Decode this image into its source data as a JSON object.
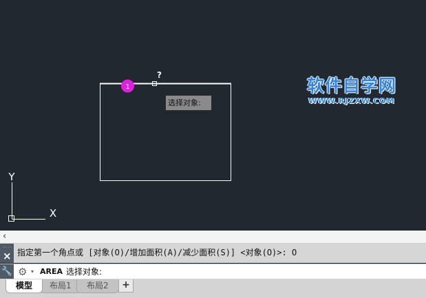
{
  "canvas": {
    "cursor_query": "?",
    "step_marker": "1",
    "axis_y_label": "Y",
    "axis_x_label": "X",
    "tooltip_text": "选择对象:"
  },
  "watermark": {
    "title": "软件自学网",
    "url": "WWW.RJZXW.COM"
  },
  "command_line": {
    "collapse_glyph": "‹",
    "history_text": "指定第一个角点或 [对象(O)/增加面积(A)/减少面积(S)] <对象(O)>: O",
    "close_glyph": "×",
    "grip_glyph": "⋯⋯",
    "customize_glyph": "⚙",
    "dropdown_glyph": "▾",
    "active_command": "AREA",
    "prompt_text": "选择对象:"
  },
  "layout_tabs": {
    "tabs": [
      "模型",
      "布局1",
      "布局2"
    ],
    "active_index": 0,
    "add_label": "+"
  },
  "colors": {
    "canvas_bg": "#212830",
    "marker": "#e020e0",
    "line": "#ffffff",
    "watermark": "#2f86e6"
  }
}
